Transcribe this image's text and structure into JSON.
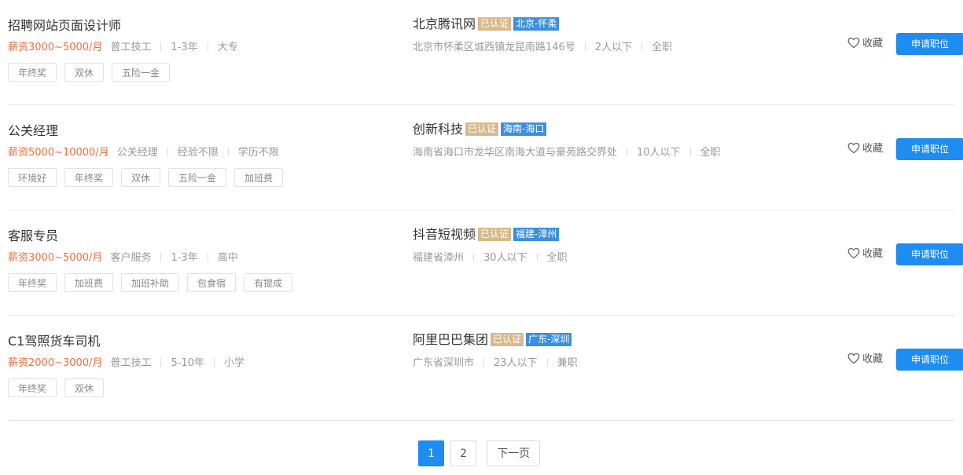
{
  "jobs": [
    {
      "title": "招聘网站页面设计师",
      "salary": "薪资3000~5000/月",
      "category": "普工技工",
      "experience": "1-3年",
      "education": "大专",
      "tags": [
        "年终奖",
        "双休",
        "五险一金"
      ],
      "company": "北京腾讯网",
      "certified": "已认证",
      "location": "北京-怀柔",
      "address": "北京市怀柔区城西镇龙昆南路146号",
      "size": "2人以下",
      "type": "全职",
      "fav_label": "收藏",
      "apply_label": "申请职位"
    },
    {
      "title": "公关经理",
      "salary": "薪资5000~10000/月",
      "category": "公关经理",
      "experience": "经验不限",
      "education": "学历不限",
      "tags": [
        "环境好",
        "年终奖",
        "双休",
        "五险一金",
        "加班费"
      ],
      "company": "创新科技",
      "certified": "已认证",
      "location": "海南-海口",
      "address": "海南省海口市龙华区南海大道与豪苑路交界处",
      "size": "10人以下",
      "type": "全职",
      "fav_label": "收藏",
      "apply_label": "申请职位"
    },
    {
      "title": "客服专员",
      "salary": "薪资3000~5000/月",
      "category": "客户服务",
      "experience": "1-3年",
      "education": "高中",
      "tags": [
        "年终奖",
        "加班费",
        "加班补助",
        "包食宿",
        "有提成"
      ],
      "company": "抖音短视频",
      "certified": "已认证",
      "location": "福建-漳州",
      "address": "福建省漳州",
      "size": "30人以下",
      "type": "全职",
      "fav_label": "收藏",
      "apply_label": "申请职位"
    },
    {
      "title": "C1驾照货车司机",
      "salary": "薪资2000~3000/月",
      "category": "普工技工",
      "experience": "5-10年",
      "education": "小学",
      "tags": [
        "年终奖",
        "双休"
      ],
      "company": "阿里巴巴集团",
      "certified": "已认证",
      "location": "广东-深圳",
      "address": "广东省深圳市",
      "size": "23人以下",
      "type": "兼职",
      "fav_label": "收藏",
      "apply_label": "申请职位"
    }
  ],
  "pagination": {
    "pages": [
      "1",
      "2"
    ],
    "current": "1",
    "next_label": "下一页"
  },
  "colors": {
    "salary": "#f26d3d",
    "certified_badge": "#d8b98d",
    "location_badge": "#3b8fdc",
    "primary": "#1e8cf0"
  },
  "icons": {
    "favorite": "heart-outline-icon"
  }
}
